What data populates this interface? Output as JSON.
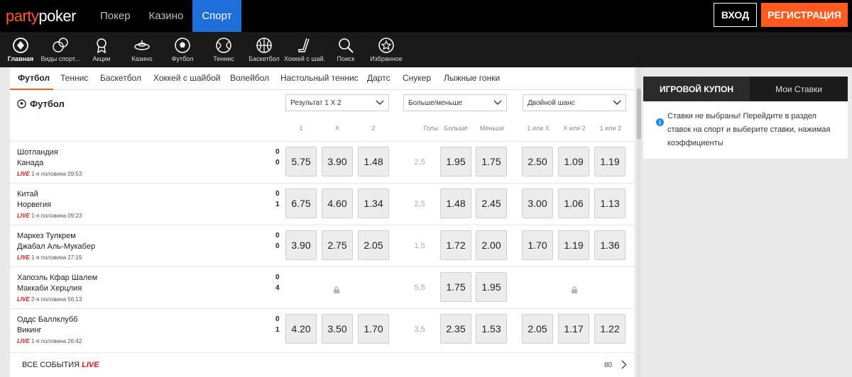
{
  "header": {
    "logo_left": "party",
    "logo_right": "poker",
    "nav": [
      {
        "label": "Покер"
      },
      {
        "label": "Казино"
      },
      {
        "label": "Спорт",
        "active": true
      }
    ],
    "login_label": "ВХОД",
    "register_label": "РЕГИСТРАЦИЯ"
  },
  "sportbar": {
    "items": [
      {
        "label": "Главная",
        "icon": "home-icon",
        "active": true
      },
      {
        "label": "Виды спорт...",
        "icon": "sports-icon"
      },
      {
        "label": "Акции",
        "icon": "promotions-icon"
      },
      {
        "label": "Казино",
        "icon": "casino-icon"
      },
      {
        "label": "Футбол",
        "icon": "football-icon"
      },
      {
        "label": "Теннис",
        "icon": "tennis-icon"
      },
      {
        "label": "Баскетбол",
        "icon": "basketball-icon"
      },
      {
        "label": "Хоккей с шай...",
        "icon": "hockey-icon"
      },
      {
        "label": "Поиск",
        "icon": "search-icon"
      },
      {
        "label": "Избранное",
        "icon": "favorites-icon"
      }
    ]
  },
  "tabs": [
    {
      "label": "Футбол",
      "active": true
    },
    {
      "label": "Теннис"
    },
    {
      "label": "Баскетбол"
    },
    {
      "label": "Хоккей с шайбой"
    },
    {
      "label": "Волейбол"
    },
    {
      "label": "Настольный теннис"
    },
    {
      "label": "Дартс"
    },
    {
      "label": "Снукер"
    },
    {
      "label": "Лыжные гонки"
    }
  ],
  "section": {
    "title": "Футбол",
    "dropdowns": [
      "Результат 1 X 2",
      "Больше/меньше",
      "Двойной шанс"
    ],
    "col_headers": [
      "1",
      "X",
      "2",
      "Голы",
      "Больше",
      "Меньше",
      "1 или X",
      "X или 2",
      "1 или 2"
    ]
  },
  "matches": [
    {
      "team1": "Шотландия",
      "team2": "Канада",
      "score1": "0",
      "score2": "0",
      "live": "LIVE",
      "period": "1-я половина 09:53",
      "r1x2": [
        "5.75",
        "3.90",
        "1.48"
      ],
      "goals": "2,5",
      "ou": [
        "1.95",
        "1.75"
      ],
      "dc": [
        "2.50",
        "1.09",
        "1.19"
      ]
    },
    {
      "team1": "Китай",
      "team2": "Норвегия",
      "score1": "0",
      "score2": "1",
      "live": "LIVE",
      "period": "1-я половина 09:23",
      "r1x2": [
        "6.75",
        "4.60",
        "1.34"
      ],
      "goals": "2,5",
      "ou": [
        "1.48",
        "2.45"
      ],
      "dc": [
        "3.00",
        "1.06",
        "1.13"
      ]
    },
    {
      "team1": "Маркез Тулкрем",
      "team2": "Джабал Аль-Мукабер",
      "score1": "0",
      "score2": "0",
      "live": "LIVE",
      "period": "1-я половина 27:19",
      "r1x2": [
        "3.90",
        "2.75",
        "2.05"
      ],
      "goals": "1,5",
      "ou": [
        "1.72",
        "2.00"
      ],
      "dc": [
        "1.70",
        "1.19",
        "1.36"
      ]
    },
    {
      "team1": "Хапоэль Кфар Шалем",
      "team2": "Маккаби Херцлия",
      "score1": "0",
      "score2": "4",
      "live": "LIVE",
      "period": "2-я половина 56:13",
      "r1x2": null,
      "goals": "5,5",
      "ou": [
        "1.75",
        "1.95"
      ],
      "dc": null
    },
    {
      "team1": "Оддс Баллклубб",
      "team2": "Викинг",
      "score1": "0",
      "score2": "1",
      "live": "LIVE",
      "period": "1-я половина 26:42",
      "r1x2": [
        "4.20",
        "3.50",
        "1.70"
      ],
      "goals": "3,5",
      "ou": [
        "2.35",
        "1.53"
      ],
      "dc": [
        "2.05",
        "1.17",
        "1.22"
      ]
    }
  ],
  "footer": {
    "all_events": "ВСЕ СОБЫТИЯ",
    "live": "LIVE",
    "count": "80"
  },
  "coupon": {
    "tab_active": "ИГРОВОЙ КУПОН",
    "tab_other": "Мои Ставки",
    "message": "Ставки не выбраны! Перейдите в раздел ставок на спорт и выберите ставки, нажимая коэффициенты"
  },
  "colors": {
    "brand_orange": "#ff5a1f",
    "sport_blue": "#1e6fd9",
    "live_red": "#d81b1b",
    "info_blue": "#1e88e5"
  }
}
